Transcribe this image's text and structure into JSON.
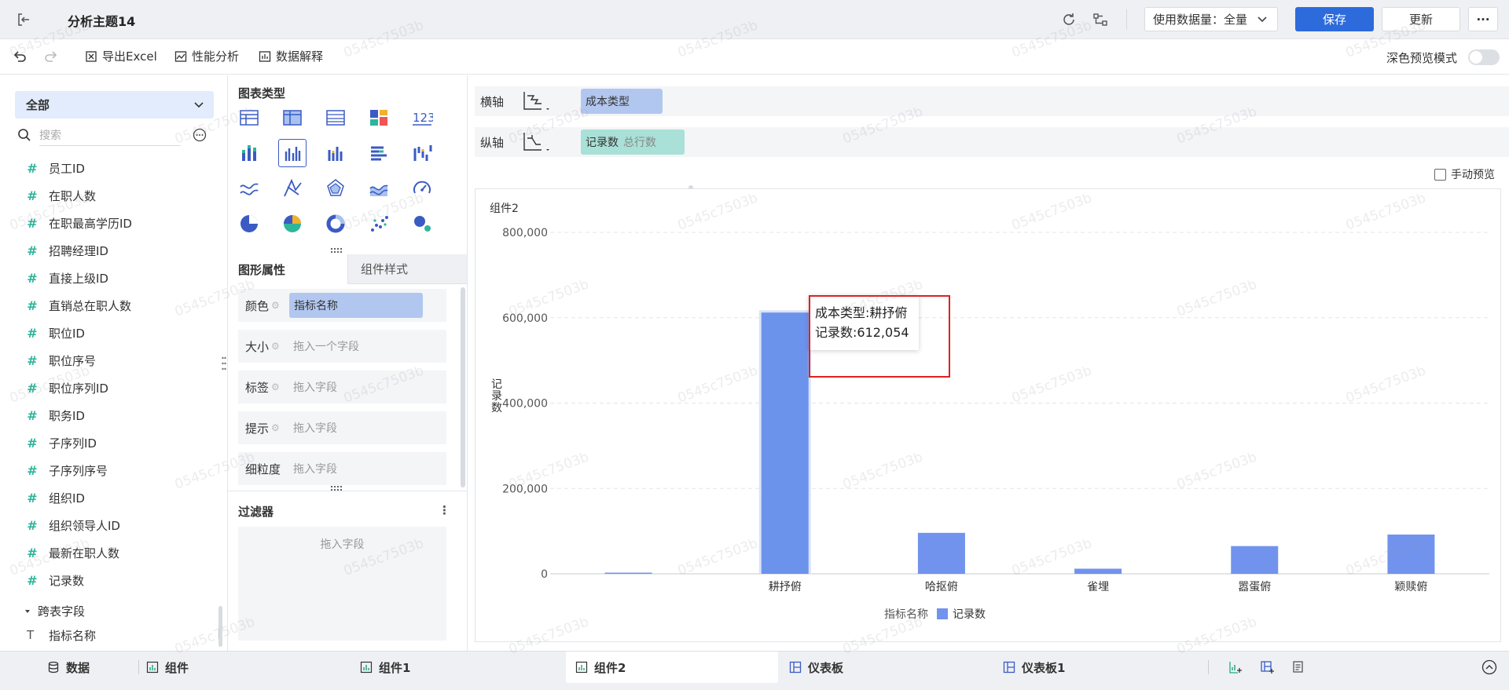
{
  "header": {
    "title": "分析主题14",
    "data_amount_label": "使用数据量：全量",
    "save": "保存",
    "update": "更新",
    "more": "···"
  },
  "toolbar": {
    "export": "导出Excel",
    "perf": "性能分析",
    "explain": "数据解释",
    "dark_mode": "深色预览模式"
  },
  "fields": {
    "scope": "全部",
    "search_placeholder": "搜索",
    "items": [
      "员工ID",
      "在职人数",
      "在职最高学历ID",
      "招聘经理ID",
      "直接上级ID",
      "直销总在职人数",
      "职位ID",
      "职位序号",
      "职位序列ID",
      "职务ID",
      "子序列ID",
      "子序列序号",
      "组织ID",
      "组织领导人ID",
      "最新在职人数",
      "记录数"
    ],
    "cross_section": "跨表字段",
    "cross_item": "指标名称"
  },
  "chart_types": {
    "title": "图表类型"
  },
  "props": {
    "tab_graphic": "图形属性",
    "tab_style": "组件样式",
    "color_label": "颜色",
    "color_value": "指标名称",
    "size_label": "大小",
    "size_ph": "拖入一个字段",
    "tag_label": "标签",
    "tag_ph": "拖入字段",
    "tip_label": "提示",
    "tip_ph": "拖入字段",
    "gran_label": "细粒度",
    "gran_ph": "拖入字段"
  },
  "filter": {
    "title": "过滤器",
    "ph": "拖入字段"
  },
  "axes": {
    "x_label": "横轴",
    "x_field": "成本类型",
    "y_label": "纵轴",
    "y_field": "记录数",
    "y_field_sub": "总行数",
    "manual_preview": "手动预览"
  },
  "chart_title": "组件2",
  "tooltip": {
    "line1": "成本类型:耕抒俯",
    "line2": "记录数:612,054"
  },
  "chart_data": {
    "type": "bar",
    "ylabel": "记录数",
    "ylim": [
      0,
      800000
    ],
    "yticks": [
      "800,000",
      "600,000",
      "400,000",
      "200,000",
      "0"
    ],
    "categories": [
      "",
      "耕抒俯",
      "哈抠俯",
      "雀埋",
      "嚣蛋俯",
      "颖赎俯"
    ],
    "series": [
      {
        "name": "记录数",
        "values": [
          2000,
          612054,
          96000,
          12000,
          65000,
          92000
        ]
      }
    ],
    "legend_title": "指标名称",
    "bar_color": "#7193ee",
    "highlight_color": "#6c93ec"
  },
  "bottom": {
    "data": "数据",
    "comp": "组件",
    "comp1": "组件1",
    "comp2": "组件2",
    "dash": "仪表板",
    "dash1": "仪表板1"
  },
  "watermark": "0545c7503b"
}
